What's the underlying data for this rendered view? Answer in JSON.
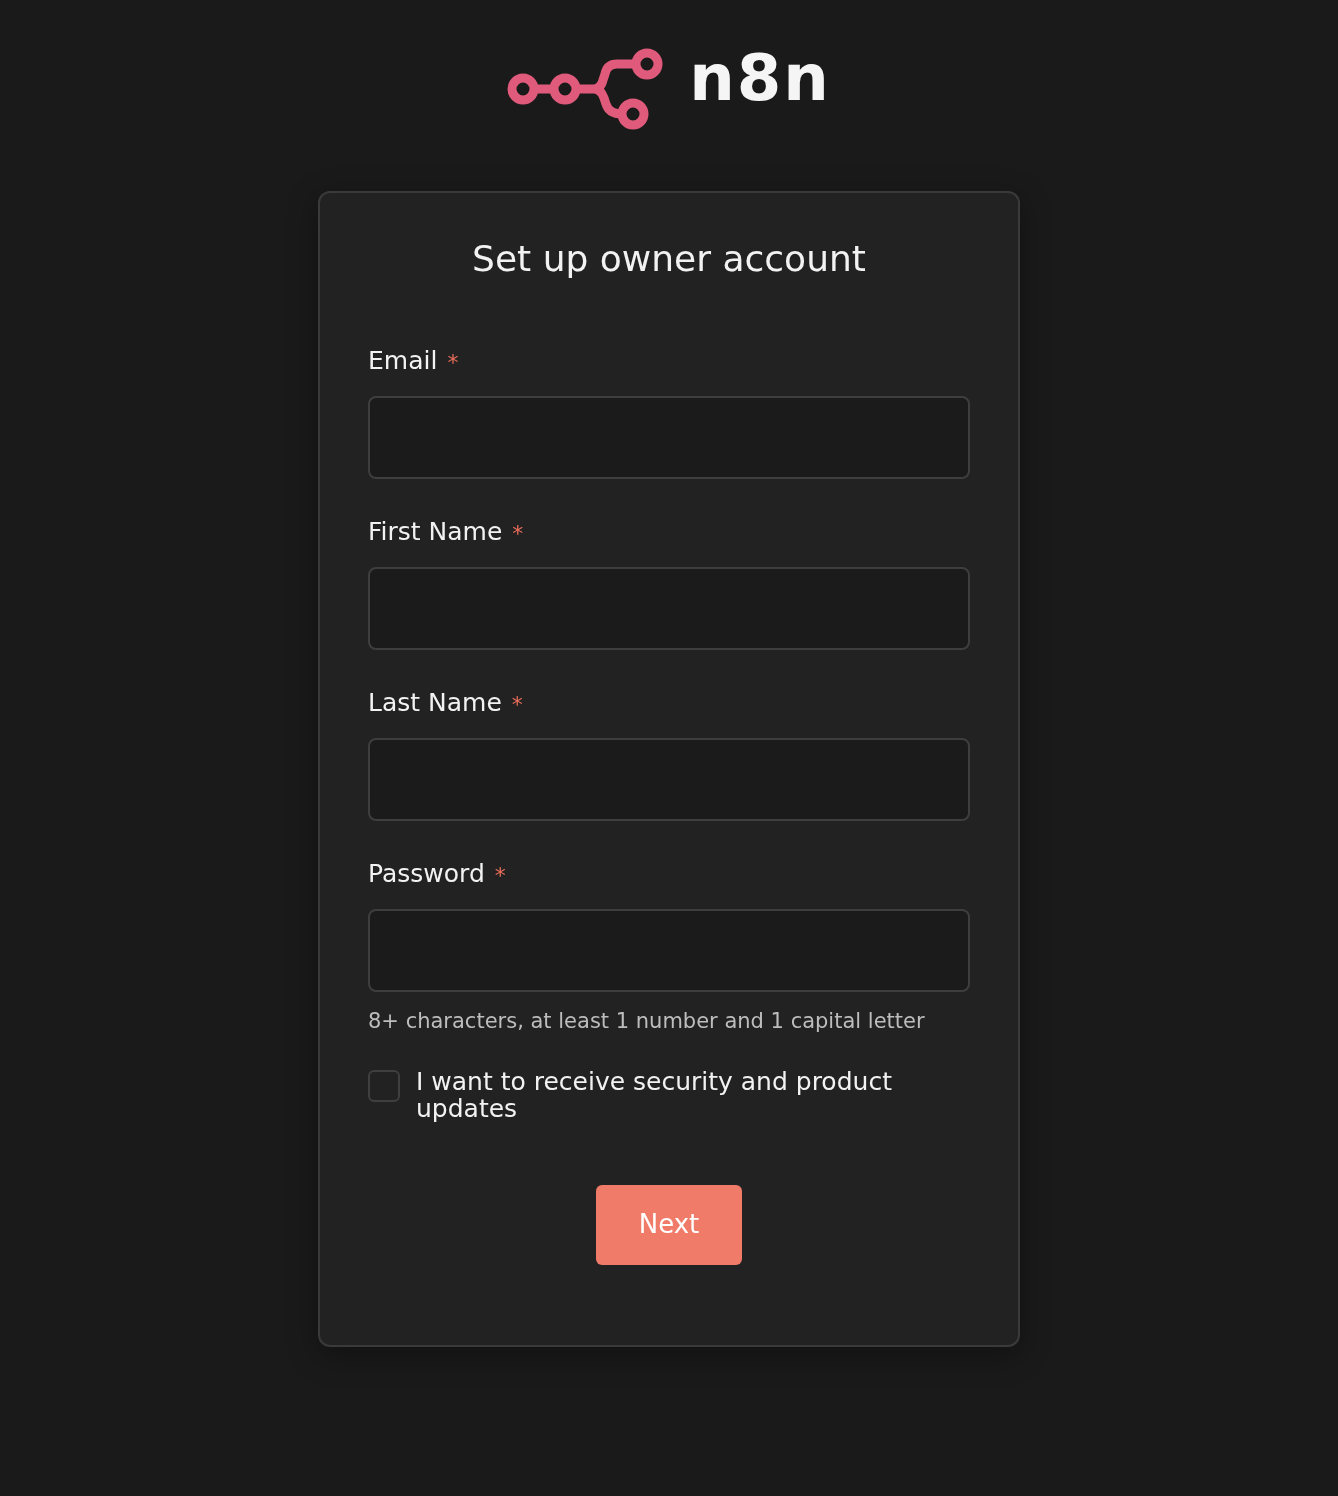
{
  "brand": {
    "name": "n8n"
  },
  "form": {
    "title": "Set up owner account",
    "fields": [
      {
        "label": "Email",
        "required_mark": "*"
      },
      {
        "label": "First Name",
        "required_mark": "*"
      },
      {
        "label": "Last Name",
        "required_mark": "*"
      },
      {
        "label": "Password",
        "required_mark": "*",
        "hint": "8+ characters, at least 1 number and 1 capital letter"
      }
    ],
    "consent": {
      "label": "I want to receive security and product updates",
      "checked": false
    },
    "submit": "Next"
  }
}
